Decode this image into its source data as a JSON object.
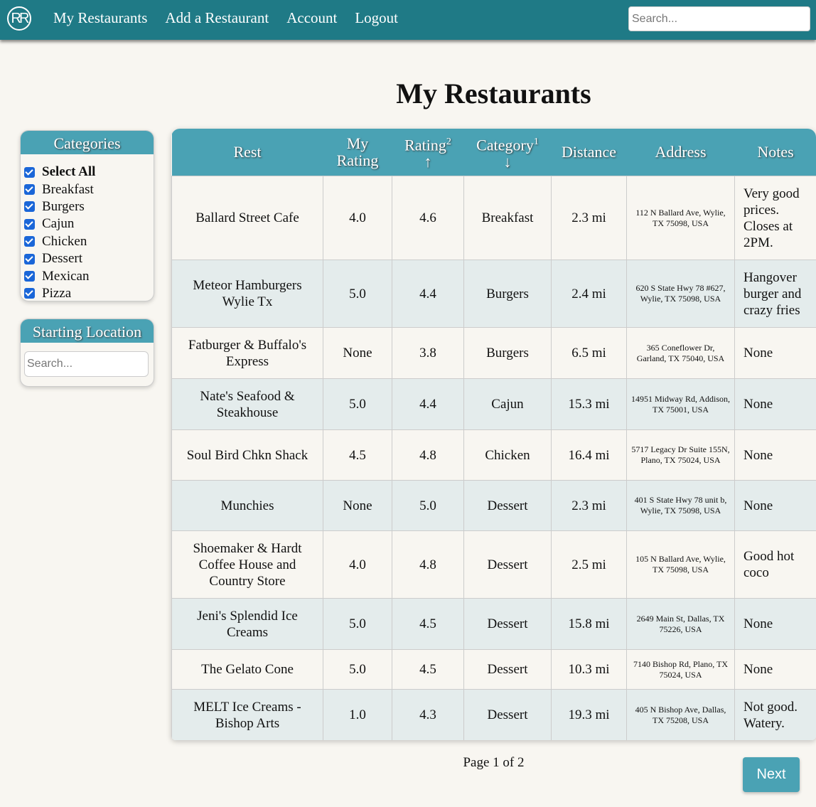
{
  "nav": {
    "logo": "RR",
    "links": [
      "My Restaurants",
      "Add a Restaurant",
      "Account",
      "Logout"
    ],
    "search_placeholder": "Search..."
  },
  "page_title": "My Restaurants",
  "categories": {
    "title": "Categories",
    "items": [
      {
        "label": "Select All",
        "checked": true
      },
      {
        "label": "Breakfast",
        "checked": true
      },
      {
        "label": "Burgers",
        "checked": true
      },
      {
        "label": "Cajun",
        "checked": true
      },
      {
        "label": "Chicken",
        "checked": true
      },
      {
        "label": "Dessert",
        "checked": true
      },
      {
        "label": "Mexican",
        "checked": true
      },
      {
        "label": "Pizza",
        "checked": true
      }
    ]
  },
  "starting_location": {
    "title": "Starting Location",
    "placeholder": "Search..."
  },
  "table": {
    "headers": {
      "rest": "Rest",
      "my_rating_1": "My",
      "my_rating_2": "Rating",
      "rating": "Rating",
      "rating_sup": "2",
      "rating_arrow": "↑",
      "category": "Category",
      "category_sup": "1",
      "category_arrow": "↓",
      "distance": "Distance",
      "address": "Address",
      "notes": "Notes"
    },
    "rows": [
      {
        "rest": "Ballard Street Cafe",
        "my_rating": "4.0",
        "rating": "4.6",
        "category": "Breakfast",
        "distance": "2.3 mi",
        "address": "112 N Ballard Ave, Wylie, TX 75098, USA",
        "notes": "Very good prices. Closes at 2PM."
      },
      {
        "rest": "Meteor Hamburgers Wylie Tx",
        "my_rating": "5.0",
        "rating": "4.4",
        "category": "Burgers",
        "distance": "2.4 mi",
        "address": "620 S State Hwy 78 #627, Wylie, TX 75098, USA",
        "notes": "Hangover burger and crazy fries"
      },
      {
        "rest": "Fatburger & Buffalo's Express",
        "my_rating": "None",
        "rating": "3.8",
        "category": "Burgers",
        "distance": "6.5 mi",
        "address": "365 Coneflower Dr, Garland, TX 75040, USA",
        "notes": "None"
      },
      {
        "rest": "Nate's Seafood & Steakhouse",
        "my_rating": "5.0",
        "rating": "4.4",
        "category": "Cajun",
        "distance": "15.3 mi",
        "address": "14951 Midway Rd, Addison, TX 75001, USA",
        "notes": "None"
      },
      {
        "rest": "Soul Bird Chkn Shack",
        "my_rating": "4.5",
        "rating": "4.8",
        "category": "Chicken",
        "distance": "16.4 mi",
        "address": "5717 Legacy Dr Suite 155N, Plano, TX 75024, USA",
        "notes": "None"
      },
      {
        "rest": "Munchies",
        "my_rating": "None",
        "rating": "5.0",
        "category": "Dessert",
        "distance": "2.3 mi",
        "address": "401 S State Hwy 78 unit b, Wylie, TX 75098, USA",
        "notes": "None"
      },
      {
        "rest": "Shoemaker & Hardt Coffee House and Country Store",
        "my_rating": "4.0",
        "rating": "4.8",
        "category": "Dessert",
        "distance": "2.5 mi",
        "address": "105 N Ballard Ave, Wylie, TX 75098, USA",
        "notes": "Good hot coco"
      },
      {
        "rest": "Jeni's Splendid Ice Creams",
        "my_rating": "5.0",
        "rating": "4.5",
        "category": "Dessert",
        "distance": "15.8 mi",
        "address": "2649 Main St, Dallas, TX 75226, USA",
        "notes": "None"
      },
      {
        "rest": "The Gelato Cone",
        "my_rating": "5.0",
        "rating": "4.5",
        "category": "Dessert",
        "distance": "10.3 mi",
        "address": "7140 Bishop Rd, Plano, TX 75024, USA",
        "notes": "None"
      },
      {
        "rest": "MELT Ice Creams - Bishop Arts",
        "my_rating": "1.0",
        "rating": "4.3",
        "category": "Dessert",
        "distance": "19.3 mi",
        "address": "405 N Bishop Ave, Dallas, TX 75208, USA",
        "notes": "Not good. Watery."
      }
    ]
  },
  "pagination": {
    "page_info": "Page 1 of 2",
    "next_label": "Next"
  },
  "colors": {
    "navbar": "#1f7a86",
    "header_teal": "#4aa2b4",
    "checkbox": "#1a66d8",
    "row_alt": "#e4ecec",
    "background": "#f8f6f1"
  }
}
